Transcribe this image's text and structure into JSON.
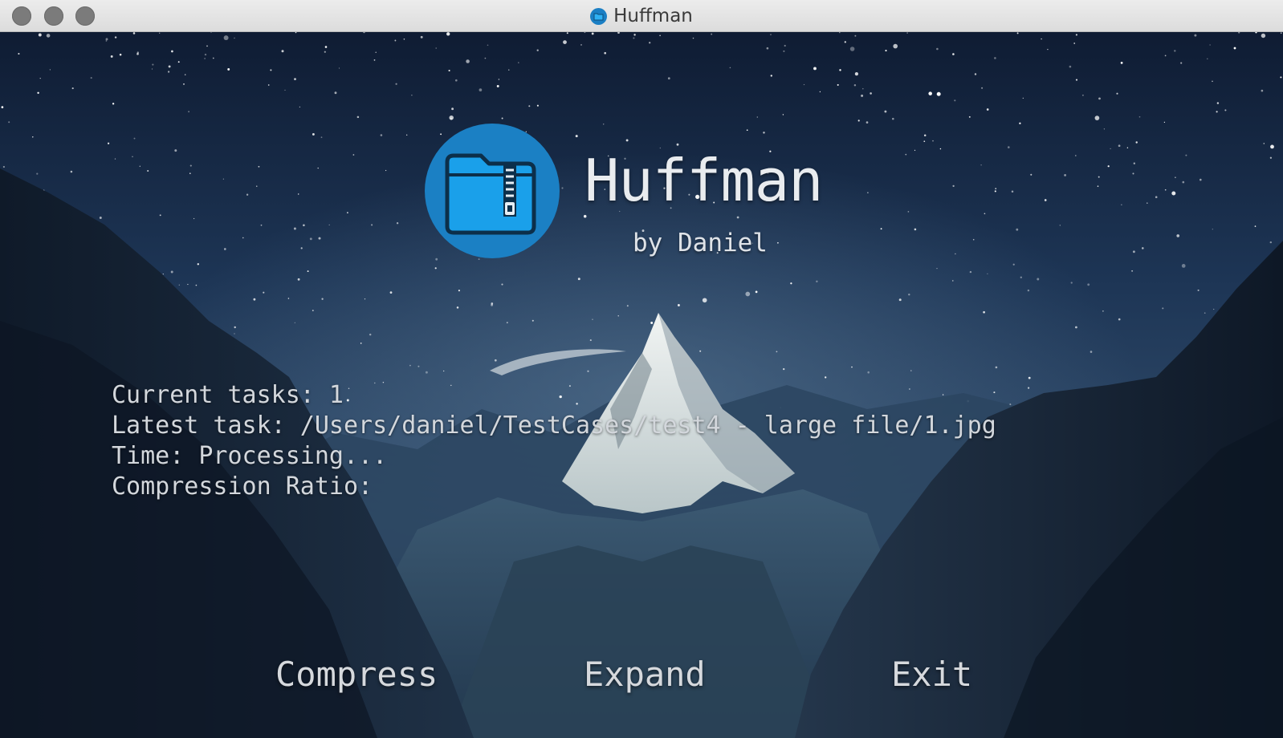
{
  "window": {
    "title": "Huffman",
    "title_icon": "archive-folder-icon"
  },
  "header": {
    "app_name": "Huffman",
    "byline": "by Daniel",
    "logo_icon": "zipped-folder-icon",
    "logo_color": "#1b80c4",
    "folder_color": "#1aa0ea"
  },
  "status": {
    "current_tasks": "Current tasks: 1",
    "latest_task": "Latest task: /Users/daniel/TestCases/test4 - large file/1.jpg",
    "time": "Time: Processing...",
    "compression_ratio": "Compression Ratio:"
  },
  "actions": {
    "compress": "Compress",
    "expand": "Expand",
    "exit": "Exit"
  }
}
